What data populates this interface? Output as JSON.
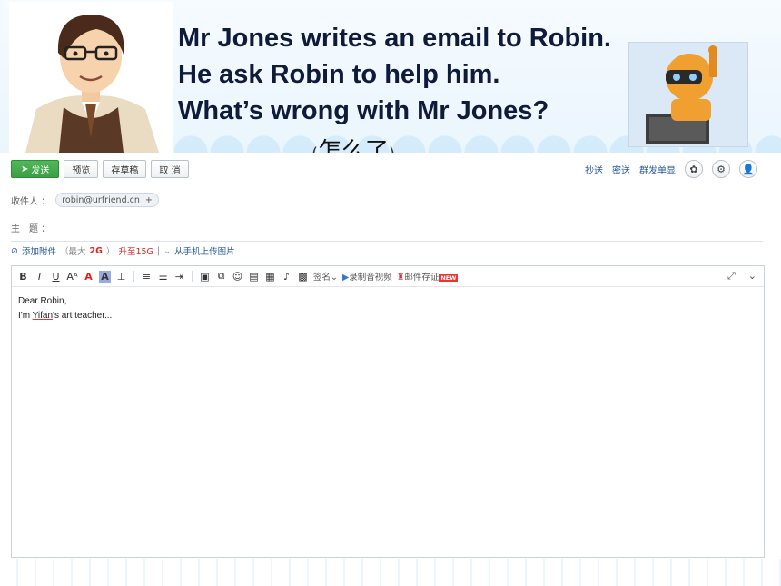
{
  "slide": {
    "title_lines": [
      "Mr Jones writes an email to Robin.",
      "He ask Robin to help him.",
      "What’s wrong with Mr Jones?"
    ],
    "note_open": "(",
    "note_text": "怎么了",
    "note_close": ")"
  },
  "toolbar": {
    "send_label": "发送",
    "preview_label": "预览",
    "draft_label": "存草稿",
    "cancel_label": "取 消"
  },
  "header_links": {
    "cc_label": "抄送",
    "bcc_label": "密送",
    "group_label": "群发单显"
  },
  "fields": {
    "to_label": "收件人 ：",
    "to_value": "robin@urfriend.cn",
    "to_plus": "+",
    "subject_label": "主　题 ："
  },
  "attach": {
    "add_label": "添加附件",
    "size_prefix": "（最大",
    "size_value": "2G",
    "size_suffix": "）",
    "upgrade_label": "升至15G",
    "divider": "|",
    "mobile_label": "从手机上传图片"
  },
  "editor_toolbar": {
    "sign_label": "签名",
    "video_label": "录制音视频",
    "proof_label": "邮件存证",
    "new_badge": "NEW"
  },
  "email_body": {
    "line1": "Dear Robin,",
    "line2_pre": "I'm ",
    "line2_name": "Yifan",
    "line2_post": "'s art teacher..."
  }
}
